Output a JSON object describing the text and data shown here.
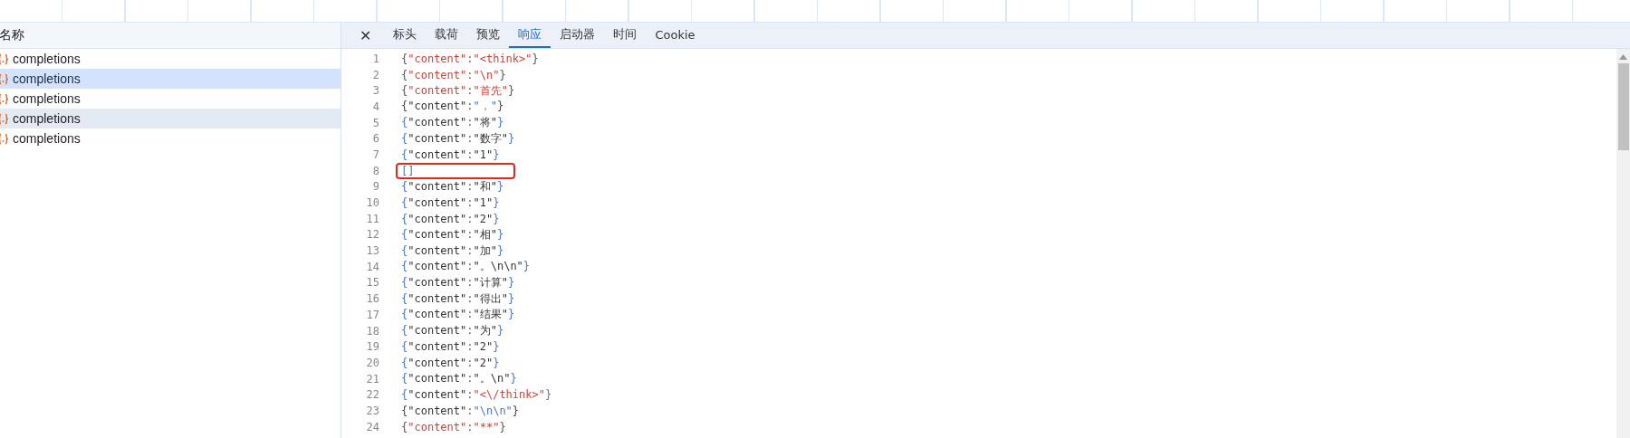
{
  "requests": {
    "column_header": "名称",
    "items": [
      {
        "name": "completions",
        "selected": false,
        "hovered": false
      },
      {
        "name": "completions",
        "selected": true,
        "hovered": false
      },
      {
        "name": "completions",
        "selected": false,
        "hovered": false
      },
      {
        "name": "completions",
        "selected": false,
        "hovered": true
      },
      {
        "name": "completions",
        "selected": false,
        "hovered": false
      }
    ]
  },
  "detail": {
    "close": "✕",
    "tabs": [
      {
        "label": "标头",
        "selected": false
      },
      {
        "label": "载荷",
        "selected": false
      },
      {
        "label": "预览",
        "selected": false
      },
      {
        "label": "响应",
        "selected": true
      },
      {
        "label": "启动器",
        "selected": false
      },
      {
        "label": "时间",
        "selected": false
      },
      {
        "label": "Cookie",
        "selected": false
      }
    ],
    "lines": [
      {
        "number": "1",
        "text": "{\"content\":\"<think>\"}",
        "kind": "hot",
        "flagged": false
      },
      {
        "number": "2",
        "text": "{\"content\":\"\\n\"}",
        "kind": "hot",
        "flagged": false
      },
      {
        "number": "3",
        "text": "{\"content\":\"首先\"}",
        "kind": "hot",
        "flagged": false
      },
      {
        "number": "4",
        "text": "{\"content\":\"，\"}",
        "kind": "plain",
        "flagged": false
      },
      {
        "number": "5",
        "text": "{\"content\":\"将\"}",
        "kind": "cool",
        "flagged": false
      },
      {
        "number": "6",
        "text": "{\"content\":\"数字\"}",
        "kind": "cool",
        "flagged": false
      },
      {
        "number": "7",
        "text": "{\"content\":\"1\"}",
        "kind": "cool",
        "flagged": false
      },
      {
        "number": "8",
        "text": "[]",
        "kind": "bracket",
        "flagged": true
      },
      {
        "number": "9",
        "text": "{\"content\":\"和\"}",
        "kind": "cool",
        "flagged": false
      },
      {
        "number": "10",
        "text": "{\"content\":\"1\"}",
        "kind": "cool",
        "flagged": false
      },
      {
        "number": "11",
        "text": "{\"content\":\"2\"}",
        "kind": "cool",
        "flagged": false
      },
      {
        "number": "12",
        "text": "{\"content\":\"相\"}",
        "kind": "cool",
        "flagged": false
      },
      {
        "number": "13",
        "text": "{\"content\":\"加\"}",
        "kind": "cool",
        "flagged": false
      },
      {
        "number": "14",
        "text": "{\"content\":\"。\\n\\n\"}",
        "kind": "cool",
        "flagged": false
      },
      {
        "number": "15",
        "text": "{\"content\":\"计算\"}",
        "kind": "cool",
        "flagged": false
      },
      {
        "number": "16",
        "text": "{\"content\":\"得出\"}",
        "kind": "cool",
        "flagged": false
      },
      {
        "number": "17",
        "text": "{\"content\":\"结果\"}",
        "kind": "cool",
        "flagged": false
      },
      {
        "number": "18",
        "text": "{\"content\":\"为\"}",
        "kind": "cool",
        "flagged": false
      },
      {
        "number": "19",
        "text": "{\"content\":\"2\"}",
        "kind": "cool",
        "flagged": false
      },
      {
        "number": "20",
        "text": "{\"content\":\"2\"}",
        "kind": "cool",
        "flagged": false
      },
      {
        "number": "21",
        "text": "{\"content\":\"。\\n\"}",
        "kind": "cool",
        "flagged": false
      },
      {
        "number": "22",
        "text": "{\"content\":\"<\\/think>\"}",
        "kind": "mixed",
        "flagged": false
      },
      {
        "number": "23",
        "text": "{\"content\":\"\\n\\n\"}",
        "kind": "plain",
        "flagged": false
      },
      {
        "number": "24",
        "text": "{\"content\":\"**\"}",
        "kind": "hot",
        "flagged": false
      }
    ]
  }
}
